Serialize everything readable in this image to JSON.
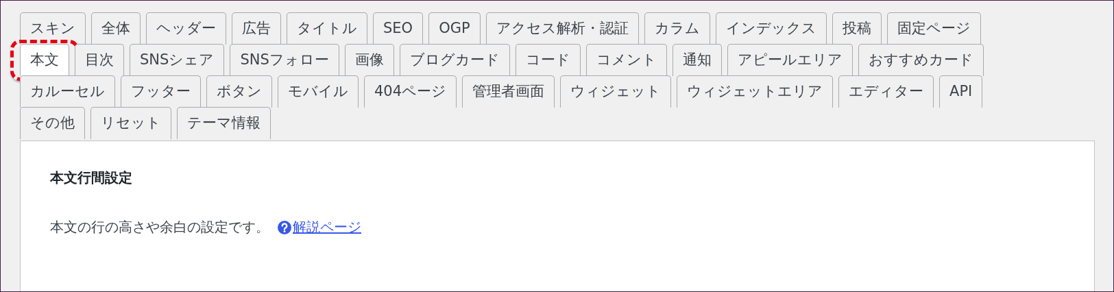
{
  "tab_rows": [
    [
      {
        "label": "スキン",
        "selected": false,
        "highlighted": false
      },
      {
        "label": "全体",
        "selected": false,
        "highlighted": false
      },
      {
        "label": "ヘッダー",
        "selected": false,
        "highlighted": false
      },
      {
        "label": "広告",
        "selected": false,
        "highlighted": false
      },
      {
        "label": "タイトル",
        "selected": false,
        "highlighted": false
      },
      {
        "label": "SEO",
        "selected": false,
        "highlighted": false
      },
      {
        "label": "OGP",
        "selected": false,
        "highlighted": false
      },
      {
        "label": "アクセス解析・認証",
        "selected": false,
        "highlighted": false
      },
      {
        "label": "カラム",
        "selected": false,
        "highlighted": false
      },
      {
        "label": "インデックス",
        "selected": false,
        "highlighted": false
      },
      {
        "label": "投稿",
        "selected": false,
        "highlighted": false
      },
      {
        "label": "固定ページ",
        "selected": false,
        "highlighted": false
      }
    ],
    [
      {
        "label": "本文",
        "selected": true,
        "highlighted": true
      },
      {
        "label": "目次",
        "selected": false,
        "highlighted": false
      },
      {
        "label": "SNSシェア",
        "selected": false,
        "highlighted": false
      },
      {
        "label": "SNSフォロー",
        "selected": false,
        "highlighted": false
      },
      {
        "label": "画像",
        "selected": false,
        "highlighted": false
      },
      {
        "label": "ブログカード",
        "selected": false,
        "highlighted": false
      },
      {
        "label": "コード",
        "selected": false,
        "highlighted": false
      },
      {
        "label": "コメント",
        "selected": false,
        "highlighted": false
      },
      {
        "label": "通知",
        "selected": false,
        "highlighted": false
      },
      {
        "label": "アピールエリア",
        "selected": false,
        "highlighted": false
      },
      {
        "label": "おすすめカード",
        "selected": false,
        "highlighted": false
      }
    ],
    [
      {
        "label": "カルーセル",
        "selected": false,
        "highlighted": false
      },
      {
        "label": "フッター",
        "selected": false,
        "highlighted": false
      },
      {
        "label": "ボタン",
        "selected": false,
        "highlighted": false
      },
      {
        "label": "モバイル",
        "selected": false,
        "highlighted": false
      },
      {
        "label": "404ページ",
        "selected": false,
        "highlighted": false
      },
      {
        "label": "管理者画面",
        "selected": false,
        "highlighted": false
      },
      {
        "label": "ウィジェット",
        "selected": false,
        "highlighted": false
      },
      {
        "label": "ウィジェットエリア",
        "selected": false,
        "highlighted": false
      },
      {
        "label": "エディター",
        "selected": false,
        "highlighted": false
      },
      {
        "label": "API",
        "selected": false,
        "highlighted": false
      }
    ],
    [
      {
        "label": "その他",
        "selected": false,
        "highlighted": false
      },
      {
        "label": "リセット",
        "selected": false,
        "highlighted": false
      },
      {
        "label": "テーマ情報",
        "selected": false,
        "highlighted": false
      }
    ]
  ],
  "panel": {
    "heading": "本文行間設定",
    "description": "本文の行の高さや余白の設定です。",
    "help_link": "解説ページ"
  }
}
